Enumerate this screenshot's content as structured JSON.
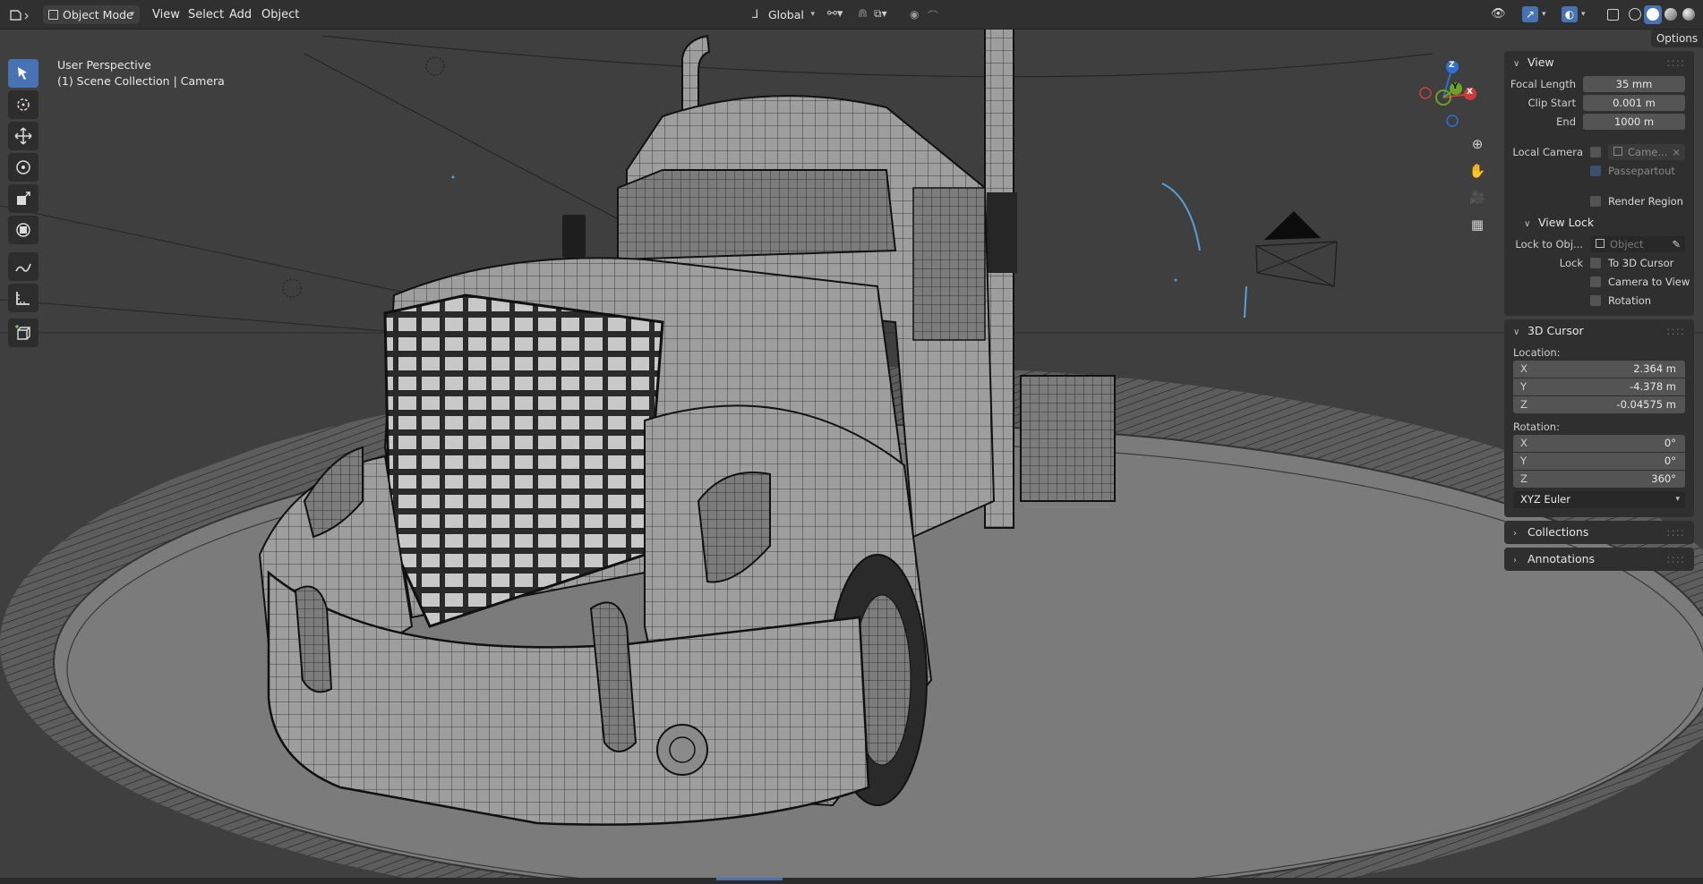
{
  "header": {
    "mode": "Object Mode",
    "menus": [
      "View",
      "Select",
      "Add",
      "Object"
    ],
    "transform_orientation": "Global"
  },
  "viewport": {
    "perspective_label": "User Perspective",
    "collection_label": "(1) Scene Collection | Camera",
    "gizmo_axes": [
      "Z",
      "Y",
      "X"
    ],
    "options_label": "Options"
  },
  "npanel": {
    "view": {
      "title": "View",
      "focal_length_label": "Focal Length",
      "focal_length": "35 mm",
      "clip_start_label": "Clip Start",
      "clip_start": "0.001 m",
      "end_label": "End",
      "end": "1000 m",
      "local_camera_label": "Local Camera",
      "local_camera_value": "Came...",
      "passepartout_label": "Passepartout",
      "render_region_label": "Render Region"
    },
    "view_lock": {
      "title": "View Lock",
      "lock_to_obj_label": "Lock to Obj...",
      "lock_to_obj_placeholder": "Object",
      "lock_label": "Lock",
      "to_3d_cursor": "To 3D Cursor",
      "camera_to_view": "Camera to View",
      "rotation": "Rotation"
    },
    "cursor": {
      "title": "3D Cursor",
      "location_label": "Location:",
      "location": [
        {
          "axis": "X",
          "value": "2.364 m"
        },
        {
          "axis": "Y",
          "value": "-4.378 m"
        },
        {
          "axis": "Z",
          "value": "-0.04575 m"
        }
      ],
      "rotation_label": "Rotation:",
      "rotation": [
        {
          "axis": "X",
          "value": "0°"
        },
        {
          "axis": "Y",
          "value": "0°"
        },
        {
          "axis": "Z",
          "value": "360°"
        }
      ],
      "rotation_mode": "XYZ Euler"
    },
    "collections_title": "Collections",
    "annotations_title": "Annotations"
  }
}
